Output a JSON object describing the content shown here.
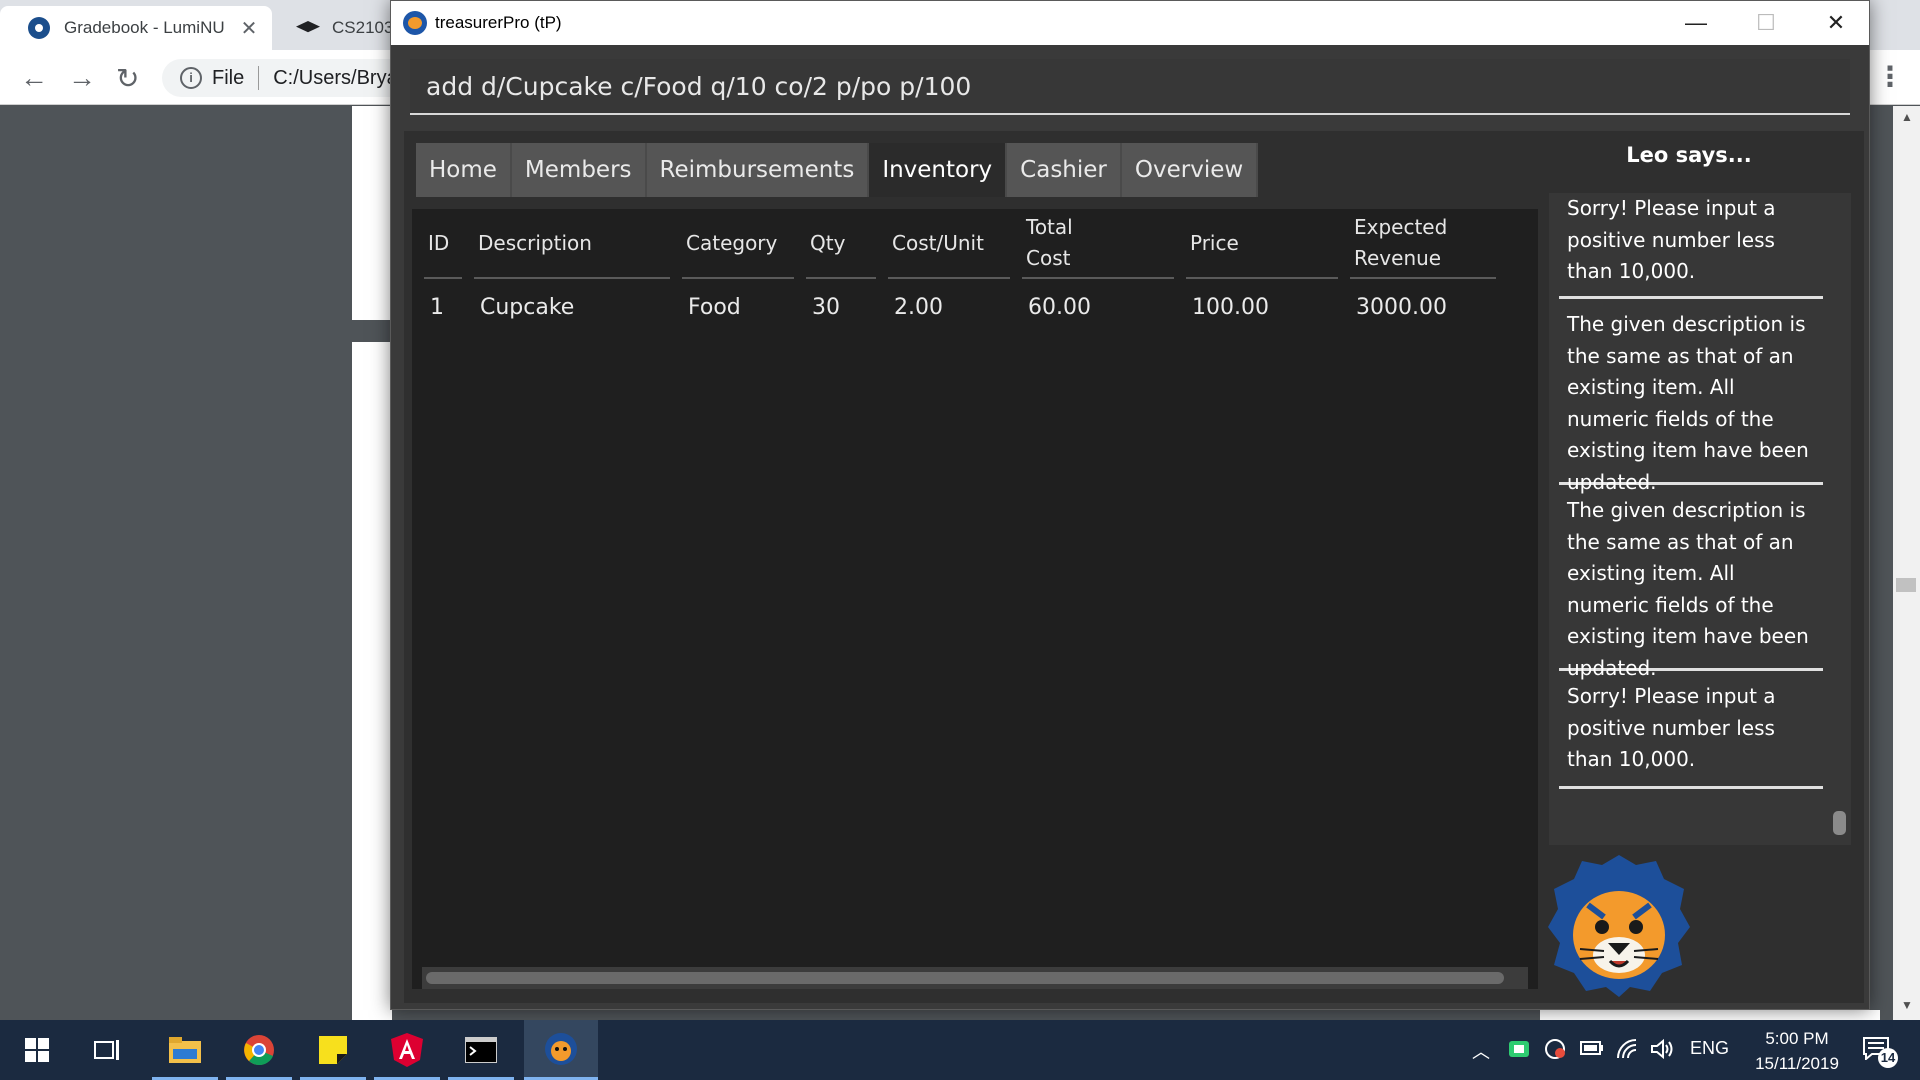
{
  "browser": {
    "tabs": [
      {
        "title": "Gradebook - LumiNU"
      },
      {
        "title": "CS2103"
      }
    ],
    "address_prefix": "File",
    "address": "C:/Users/Brya"
  },
  "app": {
    "window_title": "treasurerPro (tP)",
    "command_text": "add d/Cupcake c/Food q/10 co/2 p/po p/100",
    "tabs": [
      {
        "label": "Home"
      },
      {
        "label": "Members"
      },
      {
        "label": "Reimbursements"
      },
      {
        "label": "Inventory"
      },
      {
        "label": "Cashier"
      },
      {
        "label": "Overview"
      }
    ],
    "active_tab": "Inventory",
    "table": {
      "headers": {
        "id": "ID",
        "description": "Description",
        "category": "Category",
        "qty": "Qty",
        "cost_unit": "Cost/Unit",
        "total_cost_1": "Total",
        "total_cost_2": "Cost",
        "price": "Price",
        "expected_revenue_1": "Expected",
        "expected_revenue_2": "Revenue"
      },
      "rows": [
        {
          "id": "1",
          "description": "Cupcake",
          "category": "Food",
          "qty": "30",
          "cost_unit": "2.00",
          "total_cost": "60.00",
          "price": "100.00",
          "expected_revenue": "3000.00"
        }
      ]
    },
    "leo": {
      "title": "Leo says...",
      "messages": [
        "Sorry! Please input a positive number less than 10,000.",
        "The given description is the same as that of an existing item. All numeric fields of the existing item have been updated.",
        "The given description is the same as that of an existing item. All numeric fields of the existing item have been updated.",
        "Sorry! Please input a positive number less than 10,000."
      ]
    }
  },
  "taskbar": {
    "language": "ENG",
    "time": "5:00 PM",
    "date": "15/11/2019",
    "notifications": "14"
  }
}
